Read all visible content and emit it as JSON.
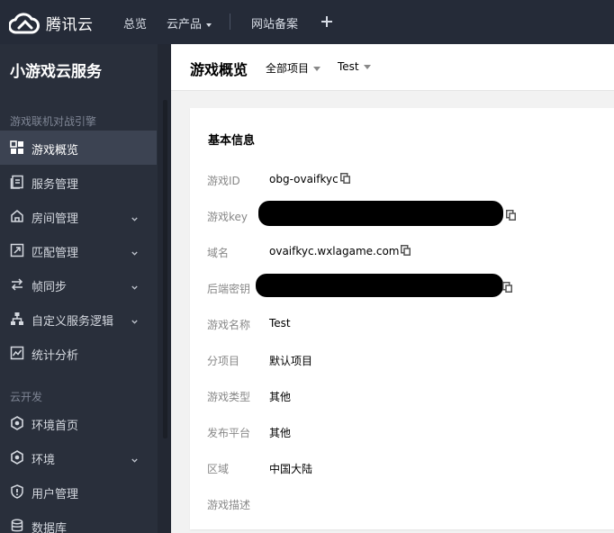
{
  "brand": {
    "name": "腾讯云",
    "logo_icon": "cloud-logo-icon"
  },
  "topnav": {
    "overview": "总览",
    "products": "云产品",
    "icp": "网站备案",
    "add_icon": "plus-icon"
  },
  "sidebar": {
    "title": "小游戏云服务",
    "groups": [
      {
        "label": "游戏联机对战引擎",
        "items": [
          {
            "label": "游戏概览",
            "icon": "grid-icon",
            "active": true,
            "expandable": false
          },
          {
            "label": "服务管理",
            "icon": "document-icon",
            "active": false,
            "expandable": false
          },
          {
            "label": "房间管理",
            "icon": "home-icon",
            "active": false,
            "expandable": true
          },
          {
            "label": "匹配管理",
            "icon": "swap-icon",
            "active": false,
            "expandable": true
          },
          {
            "label": "帧同步",
            "icon": "sync-icon",
            "active": false,
            "expandable": true
          },
          {
            "label": "自定义服务逻辑",
            "icon": "hierarchy-icon",
            "active": false,
            "expandable": true
          },
          {
            "label": "统计分析",
            "icon": "chart-icon",
            "active": false,
            "expandable": false
          }
        ]
      },
      {
        "label": "云开发",
        "items": [
          {
            "label": "环境首页",
            "icon": "hexagon-icon",
            "active": false,
            "expandable": false
          },
          {
            "label": "环境",
            "icon": "hexagon-icon",
            "active": false,
            "expandable": true
          },
          {
            "label": "用户管理",
            "icon": "user-shield-icon",
            "active": false,
            "expandable": false
          },
          {
            "label": "数据库",
            "icon": "database-icon",
            "active": false,
            "expandable": false
          }
        ]
      }
    ]
  },
  "header": {
    "title": "游戏概览",
    "project_select": "全部项目",
    "game_select": "Test"
  },
  "card": {
    "title": "基本信息",
    "fields": [
      {
        "label": "游戏ID",
        "value": "obg-ovaifkyc",
        "copyable": true
      },
      {
        "label": "游戏key",
        "value": "",
        "copyable": true,
        "redacted": true
      },
      {
        "label": "域名",
        "value": "ovaifkyc.wxlagame.com",
        "copyable": true
      },
      {
        "label": "后端密钥",
        "value": "",
        "copyable": true,
        "redacted": true
      },
      {
        "label": "游戏名称",
        "value": "Test",
        "copyable": false
      },
      {
        "label": "分项目",
        "value": "默认项目",
        "copyable": false
      },
      {
        "label": "游戏类型",
        "value": "其他",
        "copyable": false
      },
      {
        "label": "发布平台",
        "value": "其他",
        "copyable": false
      },
      {
        "label": "区域",
        "value": "中国大陆",
        "copyable": false
      },
      {
        "label": "游戏描述",
        "value": "",
        "copyable": false
      }
    ]
  },
  "colors": {
    "topbar": "#252b38",
    "sidebar": "#292f3b",
    "sidebar_active": "#3c4352",
    "content_bg": "#f2f2f2"
  }
}
